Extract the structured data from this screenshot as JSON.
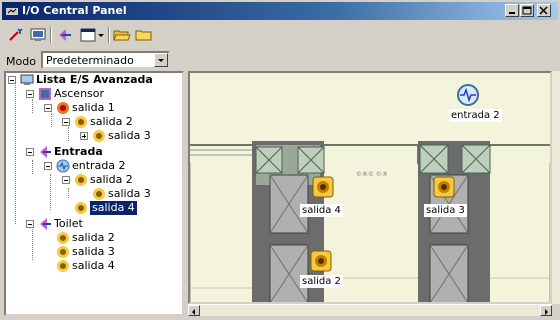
{
  "window": {
    "title": "I/O Central Panel"
  },
  "mode": {
    "label": "Modo",
    "value": "Predeterminado"
  },
  "tree": {
    "root": "Lista E/S Avanzada",
    "ascensor": "Ascensor",
    "asc_salida1": "salida 1",
    "asc_salida2": "salida 2",
    "asc_salida3": "salida 3",
    "entrada": "Entrada",
    "ent_entrada2": "entrada 2",
    "ent_salida2": "salida 2",
    "ent_salida3": "salida 3",
    "ent_salida4": "salida 4",
    "toilet": "Toilet",
    "toi_salida2": "salida 2",
    "toi_salida3": "salida 3",
    "toi_salida4": "salida 4"
  },
  "map": {
    "entrada2": "entrada 2",
    "salida4": "salida 4",
    "salida3": "salida 3",
    "salida2": "salida 2",
    "tiny": "©®© ©®"
  },
  "colors": {
    "title_start": "#0a246a",
    "selection": "#0a246a",
    "map_bg": "#f4f4dc"
  },
  "icons": [
    "wand-icon",
    "monitor-icon",
    "arrow-icon",
    "window-icon",
    "folder-open-icon",
    "folder-icon",
    "speaker-icon",
    "sensor-icon"
  ]
}
